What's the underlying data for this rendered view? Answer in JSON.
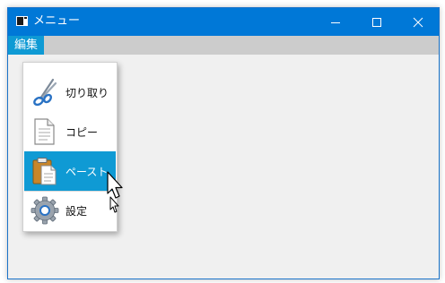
{
  "window": {
    "title": "メニュー",
    "title_color": "#0078d7",
    "buttons": {
      "minimize_icon": "minimize-icon",
      "maximize_icon": "maximize-icon",
      "close_icon": "close-icon"
    }
  },
  "menubar": {
    "items": [
      {
        "label": "編集",
        "active": true
      }
    ]
  },
  "dropdown": {
    "items": [
      {
        "label": "切り取り",
        "icon": "scissors-icon",
        "selected": false
      },
      {
        "label": "コピー",
        "icon": "document-icon",
        "selected": false
      },
      {
        "label": "ペースト",
        "icon": "clipboard-icon",
        "selected": true
      },
      {
        "label": "設定",
        "icon": "gear-icon",
        "selected": false
      }
    ],
    "highlight_color": "#0f9ad4"
  }
}
